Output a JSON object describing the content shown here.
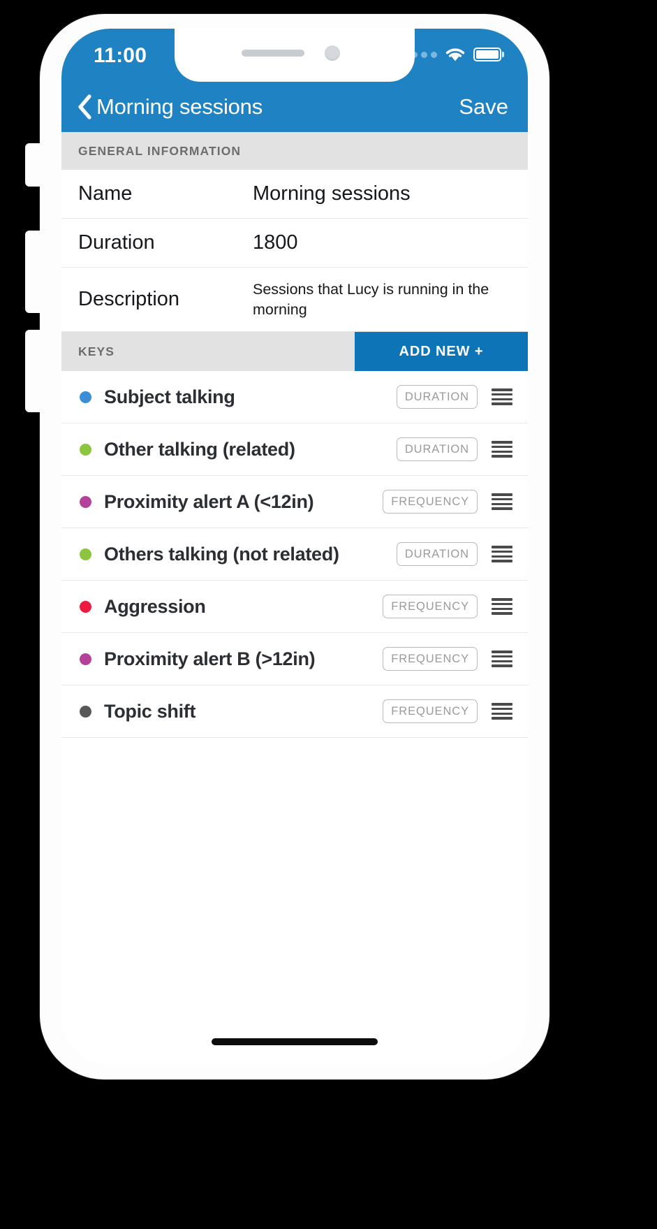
{
  "theme": {
    "brand_blue": "#1f82c3",
    "action_blue": "#0d74b8",
    "section_gray": "#e2e2e2",
    "label_gray": "#6d6d6d",
    "badge_gray": "#9a9a9a"
  },
  "status_bar": {
    "time": "11:00",
    "signal_icon": "signal-dots-icon",
    "wifi_icon": "wifi-icon",
    "battery_icon": "battery-full-icon"
  },
  "nav_bar": {
    "back_icon": "back-chevron-icon",
    "title": "Morning sessions",
    "save_label": "Save"
  },
  "general_information": {
    "header": "GENERAL INFORMATION",
    "rows": [
      {
        "label": "Name",
        "value": "Morning sessions",
        "multiline": false
      },
      {
        "label": "Duration",
        "value": "1800",
        "multiline": false
      },
      {
        "label": "Description",
        "value": "Sessions that Lucy is running in the morning",
        "multiline": true
      }
    ]
  },
  "keys_section": {
    "header": "KEYS",
    "add_new_label": "ADD NEW +",
    "rows": [
      {
        "label": "Subject talking",
        "type": "DURATION",
        "color": "#3a8dd8",
        "handle_icon": "drag-handle-icon"
      },
      {
        "label": "Other talking (related)",
        "type": "DURATION",
        "color": "#8cc63f",
        "handle_icon": "drag-handle-icon"
      },
      {
        "label": "Proximity alert A (<12in)",
        "type": "FREQUENCY",
        "color": "#b5429a",
        "handle_icon": "drag-handle-icon"
      },
      {
        "label": "Others talking (not related)",
        "type": "DURATION",
        "color": "#8cc63f",
        "handle_icon": "drag-handle-icon"
      },
      {
        "label": "Aggression",
        "type": "FREQUENCY",
        "color": "#ec1b3f",
        "handle_icon": "drag-handle-icon"
      },
      {
        "label": "Proximity alert B (>12in)",
        "type": "FREQUENCY",
        "color": "#b5429a",
        "handle_icon": "drag-handle-icon"
      },
      {
        "label": "Topic shift",
        "type": "FREQUENCY",
        "color": "#585858",
        "handle_icon": "drag-handle-icon"
      }
    ]
  },
  "device": {
    "speaker_icon": "speaker-grille-icon",
    "camera_icon": "front-camera-icon",
    "home_indicator_icon": "home-indicator-icon",
    "buttons": [
      "silent-switch",
      "volume-up-button",
      "volume-down-button"
    ]
  }
}
